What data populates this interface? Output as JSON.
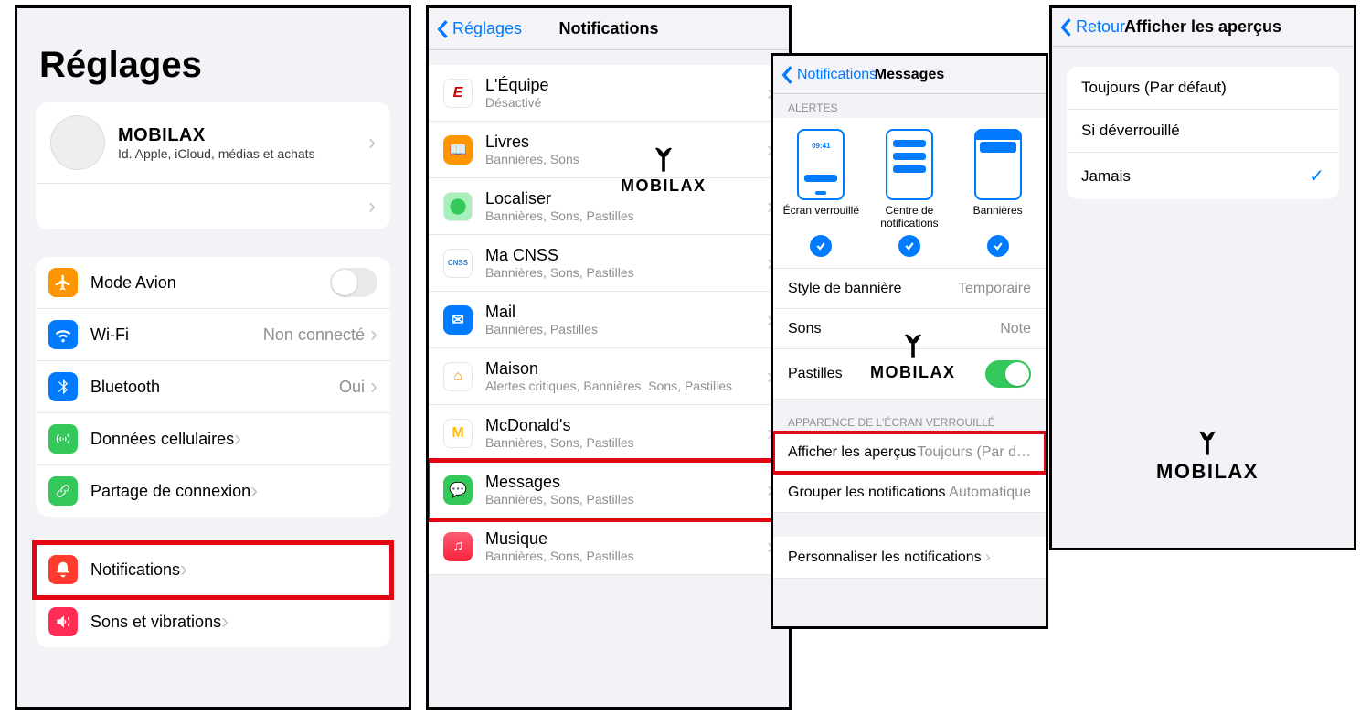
{
  "watermark": "MOBILAX",
  "panel1": {
    "title": "Réglages",
    "account_name": "MOBILAX",
    "account_sub": "Id. Apple, iCloud, médias et achats",
    "rows": [
      {
        "label": "Mode Avion",
        "value": "",
        "type": "toggle"
      },
      {
        "label": "Wi-Fi",
        "value": "Non connecté"
      },
      {
        "label": "Bluetooth",
        "value": "Oui"
      },
      {
        "label": "Données cellulaires",
        "value": ""
      },
      {
        "label": "Partage de connexion",
        "value": ""
      }
    ],
    "rows2": [
      {
        "label": "Notifications",
        "highlight": true
      },
      {
        "label": "Sons et vibrations"
      }
    ]
  },
  "panel2": {
    "back": "Réglages",
    "title": "Notifications",
    "items": [
      {
        "t": "L'Équipe",
        "s": "Désactivé"
      },
      {
        "t": "Livres",
        "s": "Bannières, Sons"
      },
      {
        "t": "Localiser",
        "s": "Bannières, Sons, Pastilles"
      },
      {
        "t": "Ma CNSS",
        "s": "Bannières, Sons, Pastilles"
      },
      {
        "t": "Mail",
        "s": "Bannières, Pastilles"
      },
      {
        "t": "Maison",
        "s": "Alertes critiques, Bannières, Sons, Pastilles"
      },
      {
        "t": "McDonald's",
        "s": "Bannières, Sons, Pastilles"
      },
      {
        "t": "Messages",
        "s": "Bannières, Sons, Pastilles",
        "highlight": true
      },
      {
        "t": "Musique",
        "s": "Bannières, Sons, Pastilles"
      }
    ]
  },
  "panel3": {
    "back": "Notifications",
    "title": "Messages",
    "section1": "ALERTES",
    "alert_time": "09:41",
    "alert_types": [
      "Écran verrouillé",
      "Centre de notifications",
      "Bannières"
    ],
    "settings": [
      {
        "lab": "Style de bannière",
        "val": "Temporaire"
      },
      {
        "lab": "Sons",
        "val": "Note"
      },
      {
        "lab": "Pastilles",
        "val": "",
        "toggle": true
      }
    ],
    "section2": "APPARENCE DE L'ÉCRAN VERROUILLÉ",
    "lock_rows": [
      {
        "lab": "Afficher les aperçus",
        "val": "Toujours (Par d…",
        "highlight": true
      },
      {
        "lab": "Grouper les notifications",
        "val": "Automatique"
      }
    ],
    "customize": "Personnaliser les notifications"
  },
  "panel4": {
    "back": "Retour",
    "title": "Afficher les aperçus",
    "options": [
      {
        "lab": "Toujours (Par défaut)",
        "selected": false
      },
      {
        "lab": "Si déverrouillé",
        "selected": false
      },
      {
        "lab": "Jamais",
        "selected": true
      }
    ]
  }
}
